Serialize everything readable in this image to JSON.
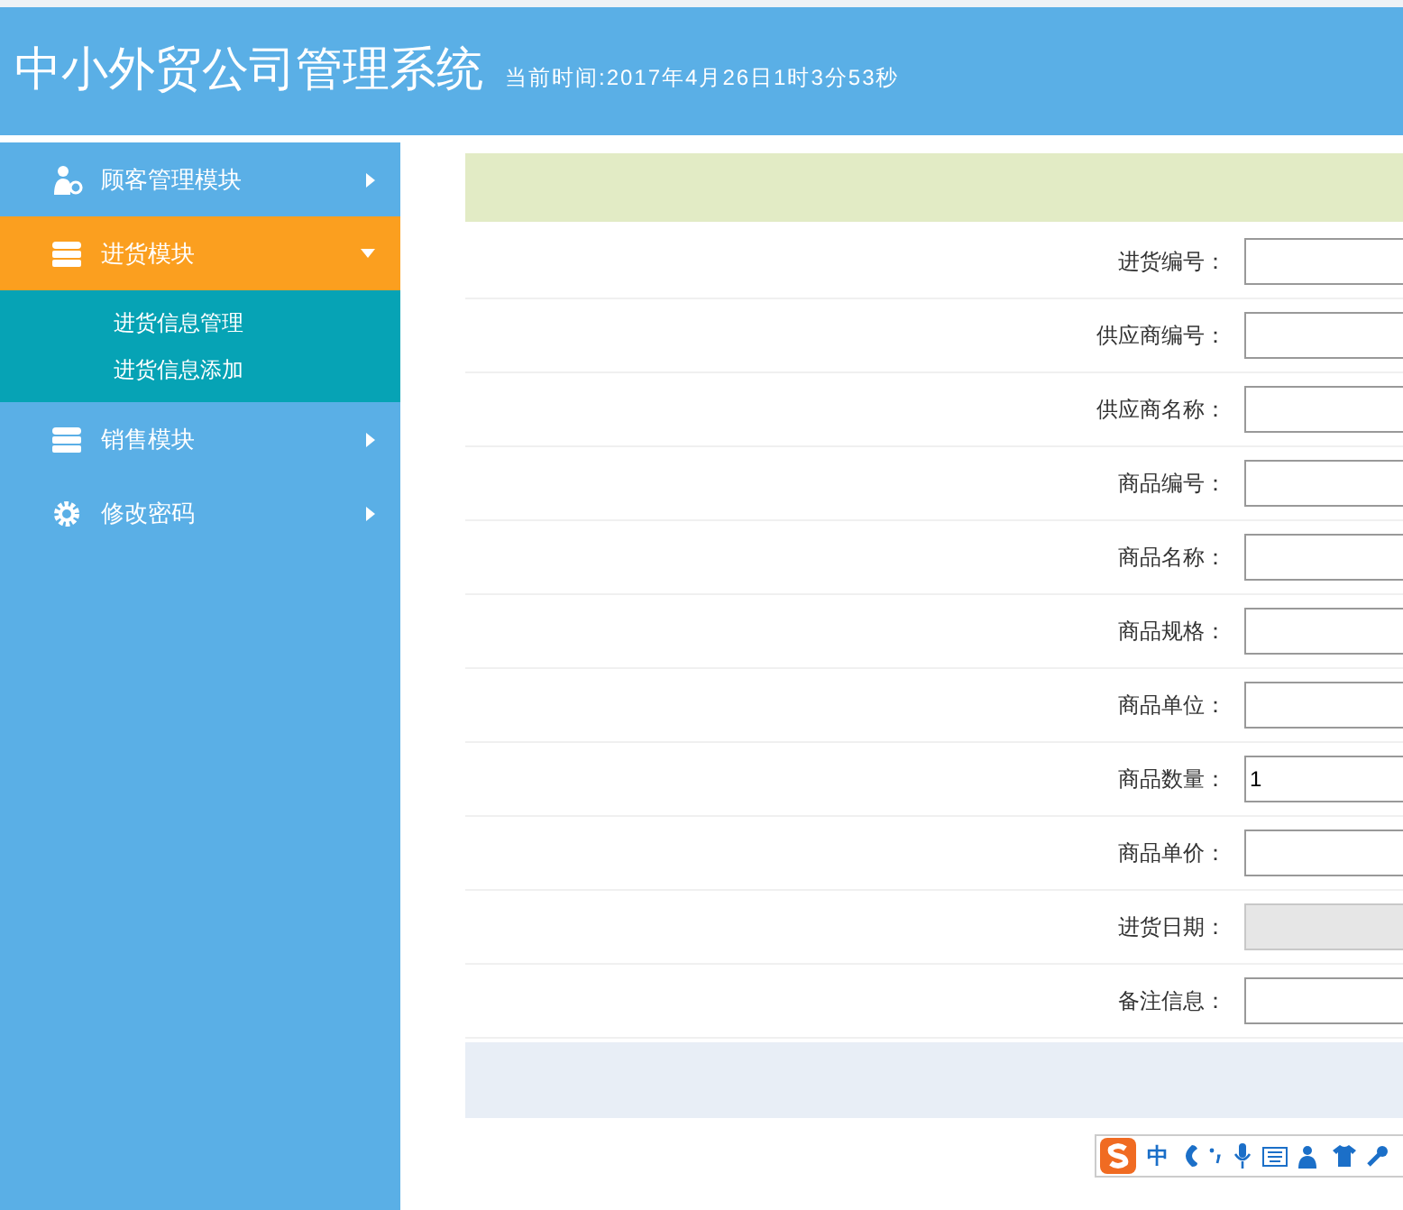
{
  "header": {
    "title": "中小外贸公司管理系统",
    "time": "当前时间:2017年4月26日1时3分53秒"
  },
  "sidebar": {
    "items": [
      {
        "label": "顾客管理模块",
        "kind": "users",
        "expanded": false,
        "selected": false
      },
      {
        "label": "进货模块",
        "kind": "stack",
        "expanded": true,
        "selected": true,
        "children": [
          {
            "label": "进货信息管理"
          },
          {
            "label": "进货信息添加"
          }
        ]
      },
      {
        "label": "销售模块",
        "kind": "stack",
        "expanded": false,
        "selected": false
      },
      {
        "label": "修改密码",
        "kind": "gear",
        "expanded": false,
        "selected": false
      }
    ]
  },
  "form": {
    "fields": [
      {
        "label": "进货编号：",
        "disabled": false
      },
      {
        "label": "供应商编号：",
        "disabled": false
      },
      {
        "label": "供应商名称：",
        "disabled": false
      },
      {
        "label": "商品编号：",
        "disabled": false
      },
      {
        "label": "商品名称：",
        "disabled": false
      },
      {
        "label": "商品规格：",
        "disabled": false
      },
      {
        "label": "商品单位：",
        "disabled": false
      },
      {
        "label": "商品数量：",
        "value": "1",
        "disabled": false
      },
      {
        "label": "商品单价：",
        "disabled": false
      },
      {
        "label": "进货日期：",
        "disabled": true
      },
      {
        "label": "备注信息：",
        "disabled": false
      }
    ]
  },
  "ime_toolbar": {
    "mode": "中"
  }
}
